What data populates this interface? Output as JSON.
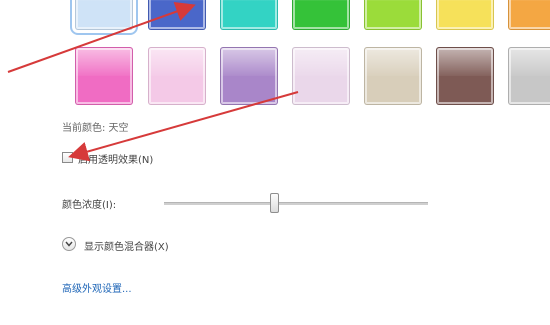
{
  "palette": {
    "row1": [
      "#cfe3f7",
      "#4a67c9",
      "#33d3c4",
      "#35c239",
      "#9bdc3a",
      "#f6e15a",
      "#f4a743"
    ],
    "row2": [
      "#f06cc3",
      "#f4c9e7",
      "#a986c9",
      "#ead7ea",
      "#d8ceba",
      "#7e5a55",
      "#c7c7c7"
    ],
    "selected": "#cfe3f7"
  },
  "current_color": "当前颜色: 天空",
  "transparency_checkbox": {
    "label": "启用透明效果(N)",
    "checked": false
  },
  "intensity": {
    "label": "颜色浓度(I):",
    "value": 0.42
  },
  "mixer_label": "显示颜色混合器(X)",
  "advanced_link": "高级外观设置...",
  "annotation_color": "#d63a3a"
}
